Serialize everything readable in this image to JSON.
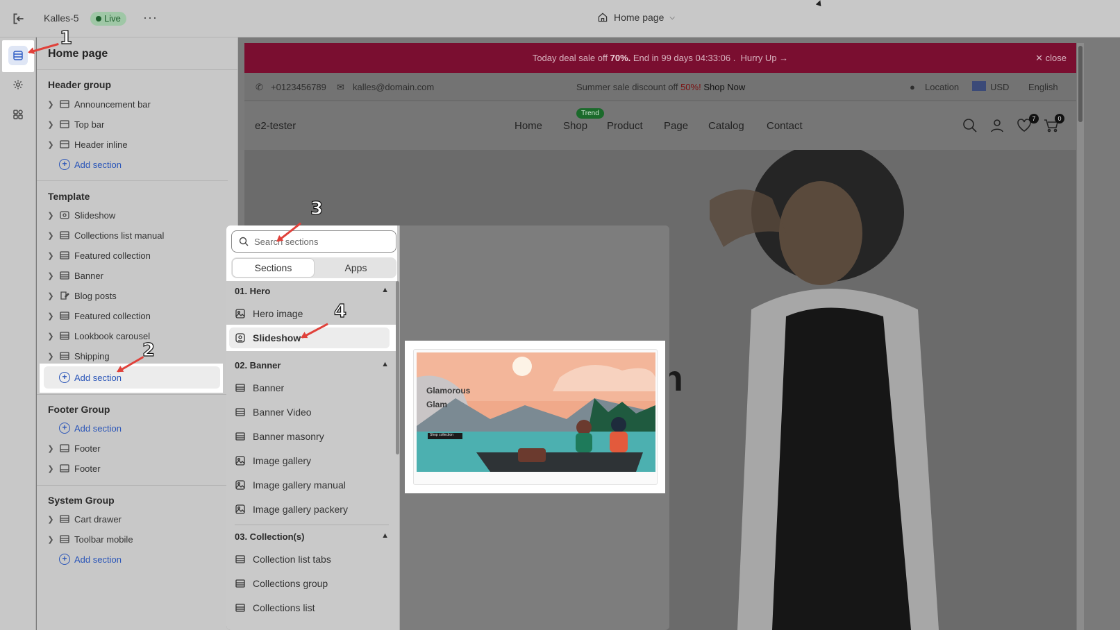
{
  "topbar": {
    "store_name": "Kalles-5",
    "live_label": "Live",
    "more_label": "···",
    "page_selector": "Home page"
  },
  "sidebar": {
    "title": "Home page",
    "header_group": {
      "title": "Header group",
      "items": [
        "Announcement bar",
        "Top bar",
        "Header inline"
      ],
      "add_label": "Add section"
    },
    "template": {
      "title": "Template",
      "items": [
        "Slideshow",
        "Collections list manual",
        "Featured collection",
        "Banner",
        "Blog posts",
        "Featured collection",
        "Lookbook carousel",
        "Shipping"
      ],
      "add_label": "Add section"
    },
    "footer_group": {
      "title": "Footer Group",
      "add_label": "Add section",
      "items": [
        "Footer",
        "Footer"
      ]
    },
    "system_group": {
      "title": "System Group",
      "items": [
        "Cart drawer",
        "Toolbar mobile"
      ],
      "add_label": "Add section"
    }
  },
  "preview": {
    "announcement": {
      "prefix": "Today deal sale off ",
      "percent": "70%.",
      "suffix": " End in 99 days 04:33:06 .",
      "cta": "Hurry Up →",
      "close": "close"
    },
    "topinfo": {
      "phone": "+0123456789",
      "email": "kalles@domain.com",
      "promo_prefix": "Summer sale discount off ",
      "promo_percent": "50%!",
      "promo_cta": " Shop Now",
      "location": "Location",
      "currency": "USD",
      "language": "English"
    },
    "header": {
      "brand": "e2-tester",
      "nav": [
        "Home",
        "Shop",
        "Product",
        "Page",
        "Catalog",
        "Contact"
      ],
      "trend_badge": "Trend",
      "wishlist_count": "7",
      "cart_count": "0"
    },
    "hero_partial_text": "n"
  },
  "picker": {
    "search_placeholder": "Search sections",
    "tabs": [
      "Sections",
      "Apps"
    ],
    "categories": [
      {
        "title": "01. Hero",
        "items": [
          "Hero image",
          "Slideshow"
        ]
      },
      {
        "title": "02. Banner",
        "items": [
          "Banner",
          "Banner Video",
          "Banner masonry",
          "Image gallery",
          "Image gallery manual",
          "Image gallery packery"
        ]
      },
      {
        "title": "03. Collection(s)",
        "items": [
          "Collection list tabs",
          "Collections group",
          "Collections list"
        ]
      }
    ],
    "thumbnail": {
      "heading_line1": "Glamorous",
      "heading_line2": "Glam",
      "button": "Shop collection"
    }
  },
  "annotations": [
    "1",
    "2",
    "3",
    "4"
  ],
  "colors": {
    "accent": "#2a55b8",
    "announcement_bg": "#7a0e30",
    "live_badge": "#9fc7a6",
    "arrow": "#e0413a"
  }
}
